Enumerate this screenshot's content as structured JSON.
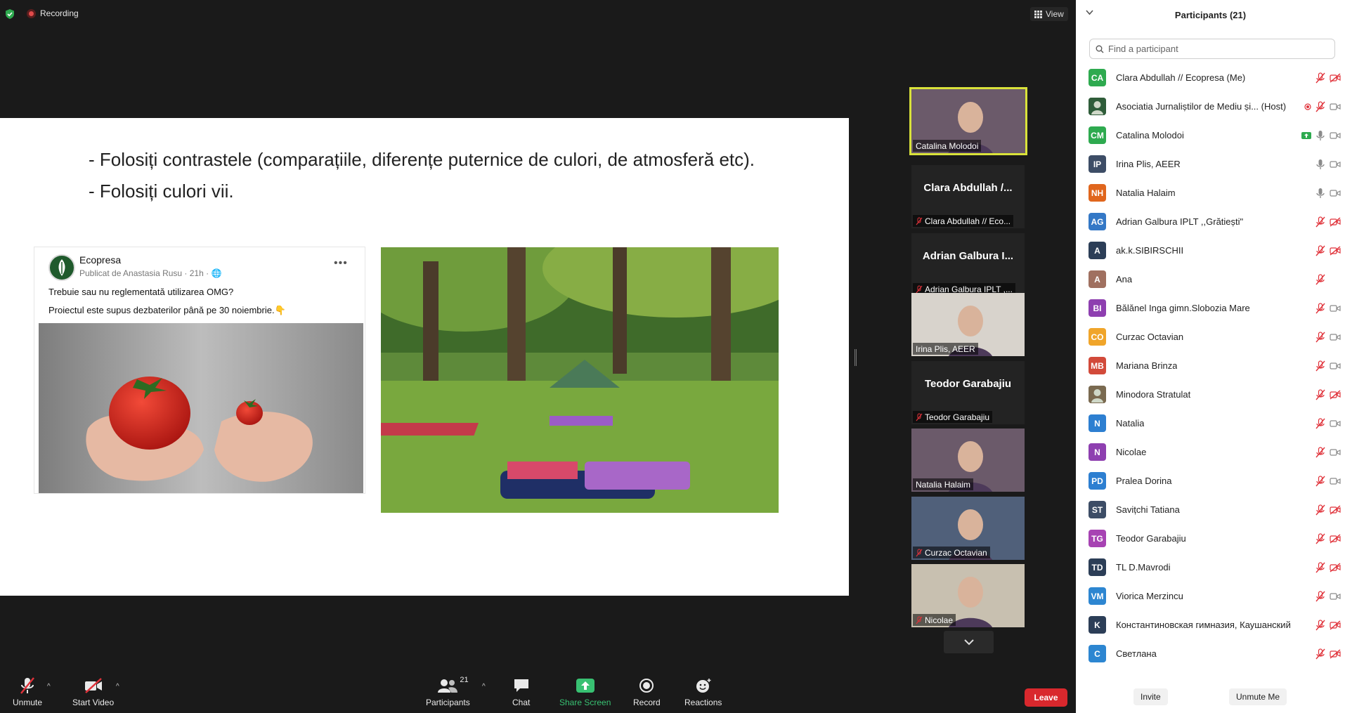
{
  "topbar": {
    "recording_label": "Recording",
    "view_label": "View"
  },
  "slide": {
    "bullet1": "Folosiți contrastele (comparațiile, diferențe puternice de culori, de atmosferă etc).",
    "bullet2": "Folosiți culori vii.",
    "bullet1_marker": "-",
    "bullet2_marker": "-",
    "fb_post": {
      "page_name": "Ecopresa",
      "subline": "Publicat de Anastasia Rusu · 21h ·",
      "line1": "Trebuie sau nu reglementată utilizarea OMG?",
      "line2": "Proiectul este supus dezbaterilor până pe 30 noiembrie.👇"
    }
  },
  "gallery": [
    {
      "label": "Catalina Molodoi",
      "bigname": "",
      "muted": false,
      "kind": "video",
      "active": true
    },
    {
      "label": "Clara Abdullah // Eco...",
      "bigname": "Clara Abdullah /...",
      "muted": true,
      "kind": "name",
      "active": false
    },
    {
      "label": "Adrian Galbura IPLT ,...",
      "bigname": "Adrian Galbura I...",
      "muted": true,
      "kind": "name",
      "active": false
    },
    {
      "label": "Irina Plis, AEER",
      "bigname": "",
      "muted": false,
      "kind": "video",
      "active": false
    },
    {
      "label": "Teodor Garabajiu",
      "bigname": "Teodor Garabajiu",
      "muted": true,
      "kind": "name",
      "active": false
    },
    {
      "label": "Natalia Halaim",
      "bigname": "",
      "muted": false,
      "kind": "video",
      "active": false
    },
    {
      "label": "Curzac Octavian",
      "bigname": "",
      "muted": true,
      "kind": "video",
      "active": false
    },
    {
      "label": "Nicolae",
      "bigname": "",
      "muted": true,
      "kind": "video",
      "active": false
    }
  ],
  "toolbar": {
    "unmute": "Unmute",
    "start_video": "Start Video",
    "participants": "Participants",
    "participants_count": "21",
    "chat": "Chat",
    "share_screen": "Share Screen",
    "record": "Record",
    "reactions": "Reactions",
    "leave": "Leave"
  },
  "panel": {
    "title": "Participants (21)",
    "search_placeholder": "Find a participant",
    "invite": "Invite",
    "unmute_me": "Unmute Me",
    "participants": [
      {
        "initials": "CA",
        "name": "Clara Abdullah // Ecopresa (Me)",
        "color": "#2eaa4f",
        "mic": "muted",
        "video": "off",
        "extra": ""
      },
      {
        "initials": "",
        "name": "Asociatia Jurnaliștilor de Mediu și... (Host)",
        "color": "#2f5d3a",
        "mic": "muted",
        "video": "on",
        "extra": "rec"
      },
      {
        "initials": "CM",
        "name": "Catalina Molodoi",
        "color": "#2eaa4f",
        "mic": "on",
        "video": "on",
        "extra": "share"
      },
      {
        "initials": "IP",
        "name": "Irina Plis, AEER",
        "color": "#3d4d66",
        "mic": "on",
        "video": "on",
        "extra": ""
      },
      {
        "initials": "NH",
        "name": "Natalia Halaim",
        "color": "#e0661d",
        "mic": "on",
        "video": "on",
        "extra": ""
      },
      {
        "initials": "AG",
        "name": "Adrian Galbura IPLT ,,Grătiești\"",
        "color": "#3478c6",
        "mic": "muted",
        "video": "off",
        "extra": ""
      },
      {
        "initials": "A",
        "name": "ak.k.SIBIRSCHII",
        "color": "#2c3e57",
        "mic": "muted",
        "video": "off",
        "extra": ""
      },
      {
        "initials": "A",
        "name": "Ana",
        "color": "#a07060",
        "mic": "muted",
        "video": "none",
        "extra": ""
      },
      {
        "initials": "BI",
        "name": "Bălănel Inga gimn.Slobozia Mare",
        "color": "#8e3fb0",
        "mic": "muted",
        "video": "on",
        "extra": ""
      },
      {
        "initials": "CO",
        "name": "Curzac Octavian",
        "color": "#f0a52a",
        "mic": "muted",
        "video": "on",
        "extra": ""
      },
      {
        "initials": "MB",
        "name": "Mariana Brinza",
        "color": "#d24a3a",
        "mic": "muted",
        "video": "on",
        "extra": ""
      },
      {
        "initials": "",
        "name": "Minodora Stratulat",
        "color": "#7a6a50",
        "mic": "muted",
        "video": "off",
        "extra": ""
      },
      {
        "initials": "N",
        "name": "Natalia",
        "color": "#2d7fd1",
        "mic": "muted",
        "video": "on",
        "extra": ""
      },
      {
        "initials": "N",
        "name": "Nicolae",
        "color": "#8e3fb0",
        "mic": "muted",
        "video": "on",
        "extra": ""
      },
      {
        "initials": "PD",
        "name": "Pralea Dorina",
        "color": "#2d7fd1",
        "mic": "muted",
        "video": "on",
        "extra": ""
      },
      {
        "initials": "ST",
        "name": "Savițchi Tatiana",
        "color": "#3d4d66",
        "mic": "muted",
        "video": "off",
        "extra": ""
      },
      {
        "initials": "TG",
        "name": "Teodor Garabajiu",
        "color": "#a743b3",
        "mic": "muted",
        "video": "off",
        "extra": ""
      },
      {
        "initials": "TD",
        "name": "TL D.Mavrodi",
        "color": "#2c3e57",
        "mic": "muted",
        "video": "off",
        "extra": ""
      },
      {
        "initials": "VM",
        "name": "Viorica Merzincu",
        "color": "#2d86d1",
        "mic": "muted",
        "video": "on",
        "extra": ""
      },
      {
        "initials": "K",
        "name": "Константиновская гимназия, Каушанский р...",
        "color": "#2c3e57",
        "mic": "muted",
        "video": "off",
        "extra": ""
      },
      {
        "initials": "C",
        "name": "Светлана",
        "color": "#2d86d1",
        "mic": "muted",
        "video": "off",
        "extra": ""
      }
    ]
  },
  "colors": {
    "accent_green": "#38c172",
    "leave_red": "#d9282d",
    "active_speaker": "#d9e23a",
    "muted_red": "#e0323a"
  }
}
